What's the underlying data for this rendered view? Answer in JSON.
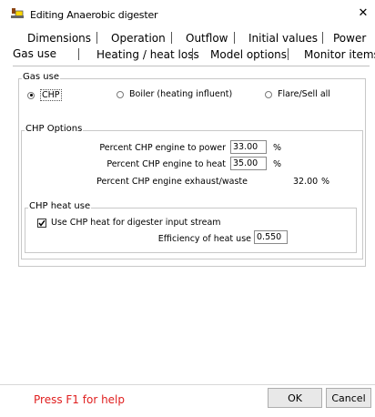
{
  "window": {
    "title": "Editing Anaerobic digester",
    "close_glyph": "✕"
  },
  "tabs": {
    "row1": [
      "Dimensions",
      "Operation",
      "Outflow",
      "Initial values",
      "Power"
    ],
    "row2": [
      "Gas use",
      "Heating / heat loss",
      "Model options",
      "Monitor items"
    ],
    "active": "Gas use"
  },
  "gas_use": {
    "legend": "Gas use",
    "options": {
      "chp": "CHP",
      "boiler": "Boiler (heating influent)",
      "flare": "Flare/Sell all"
    },
    "selected": "CHP"
  },
  "chp_options": {
    "legend": "CHP Options",
    "power_label": "Percent CHP engine to power",
    "power_value": "33.00",
    "power_unit": "%",
    "heat_label": "Percent CHP engine to heat",
    "heat_value": "35.00",
    "heat_unit": "%",
    "exhaust_label": "Percent CHP engine exhaust/waste",
    "exhaust_value": "32.00",
    "exhaust_unit": "%"
  },
  "chp_heat_use": {
    "legend": "CHP heat use",
    "checkbox_label": "Use CHP heat for digester input stream",
    "checked": true,
    "efficiency_label": "Efficiency of heat use",
    "efficiency_value": "0.550"
  },
  "footer": {
    "help": "Press F1 for help",
    "ok": "OK",
    "cancel": "Cancel",
    "help_color": "#e01e1e"
  }
}
